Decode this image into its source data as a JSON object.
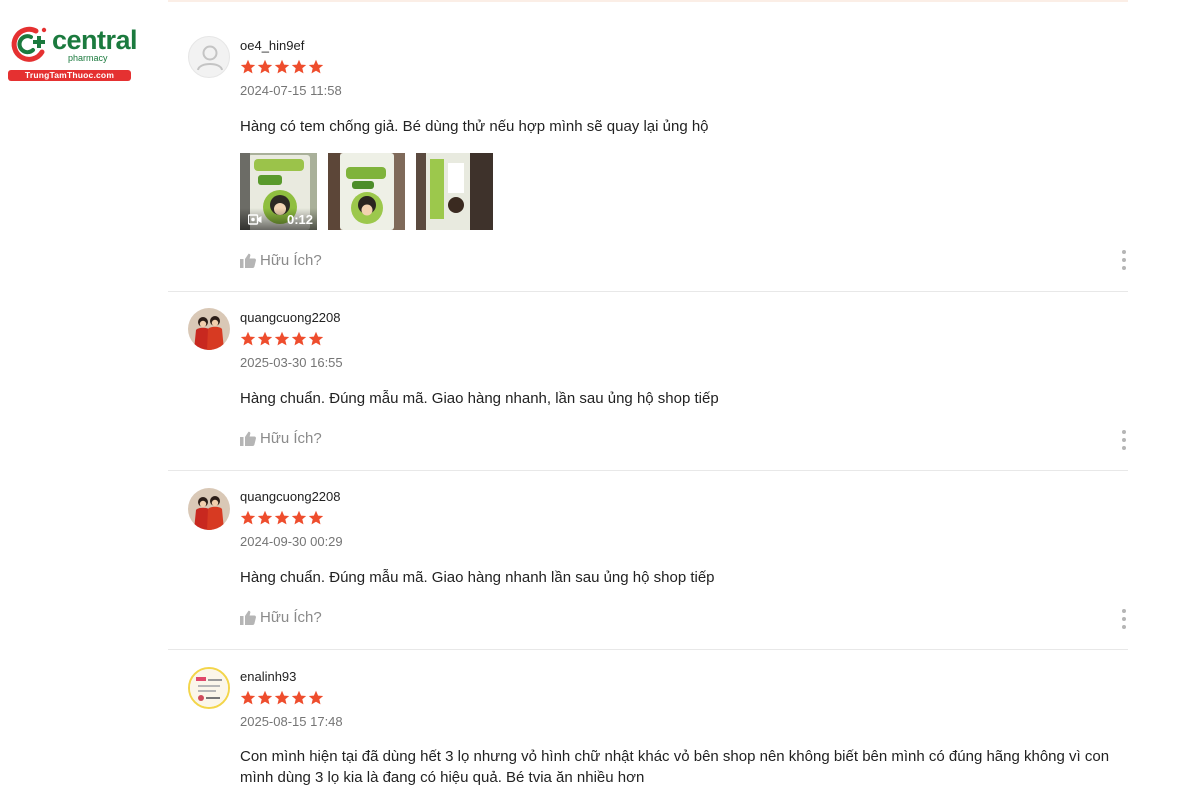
{
  "logo": {
    "name": "central",
    "sub": "pharmacy",
    "domain": "TrungTamThuoc.com"
  },
  "icons": {
    "star": "star-icon",
    "helpful": "thumb-up-icon",
    "more": "more-vertical-icon",
    "video": "video-camera-icon"
  },
  "colors": {
    "star": "#ee4d2d",
    "brand_green": "#1b7a3e",
    "brand_red": "#e53131",
    "muted": "#8a8a8a"
  },
  "reviews": [
    {
      "username": "oe4_hin9ef",
      "rating": 5,
      "date": "2024-07-15 11:58",
      "text": "Hàng có tem chống giả. Bé dùng thử nếu hợp mình sẽ quay lại ủng hộ",
      "video_duration": "0:12",
      "helpful": "Hữu Ích?"
    },
    {
      "username": "quangcuong2208",
      "rating": 5,
      "date": "2025-03-30 16:55",
      "text": "Hàng chuẩn. Đúng mẫu mã. Giao hàng nhanh, lần sau ủng hộ shop tiếp",
      "helpful": "Hữu Ích?"
    },
    {
      "username": "quangcuong2208",
      "rating": 5,
      "date": "2024-09-30 00:29",
      "text": "Hàng chuẩn. Đúng mẫu mã. Giao hàng nhanh lần sau ủng hộ shop tiếp",
      "helpful": "Hữu Ích?"
    },
    {
      "username": "enalinh93",
      "rating": 5,
      "date": "2025-08-15 17:48",
      "text": "Con mình hiện tại đã dùng hết 3 lọ nhưng vỏ hình chữ nhật khác vỏ bên shop nên không biết bên mình có đúng hãng không vì con mình dùng 3 lọ kia là đang có hiệu quả. Bé tvia ăn nhiều hơn"
    }
  ]
}
